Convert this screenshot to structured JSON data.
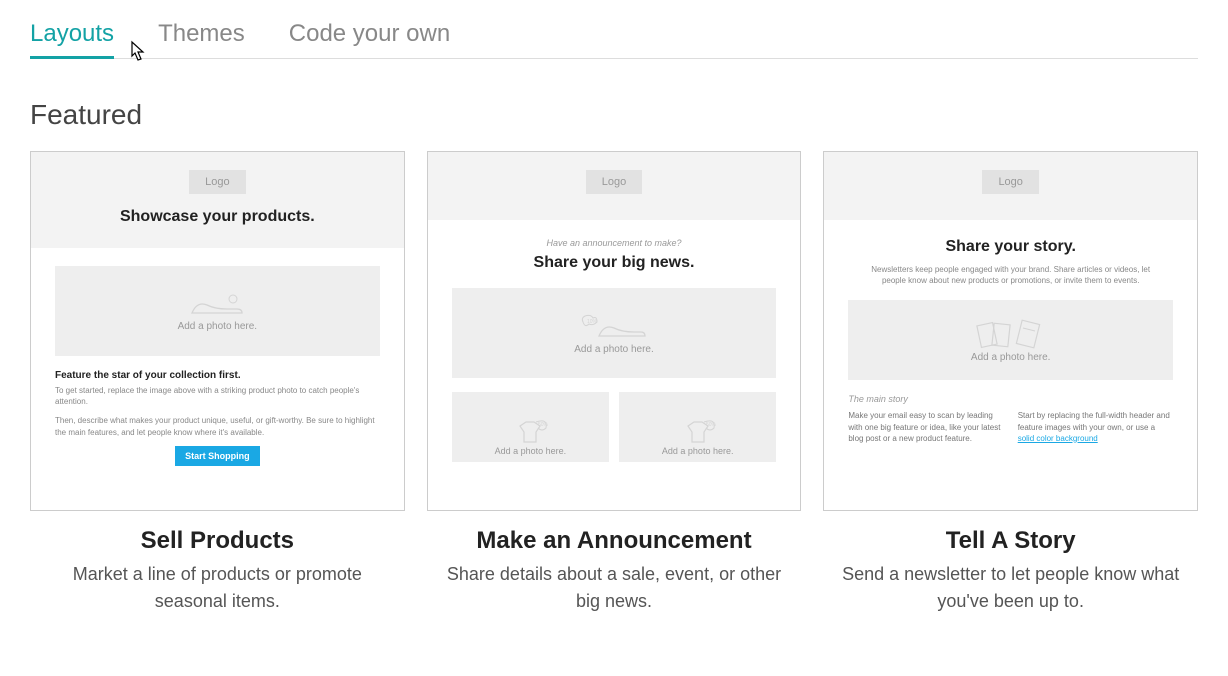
{
  "tabs": [
    {
      "label": "Layouts",
      "active": true
    },
    {
      "label": "Themes",
      "active": false
    },
    {
      "label": "Code your own",
      "active": false
    }
  ],
  "section_title": "Featured",
  "cards": [
    {
      "title": "Sell Products",
      "desc": "Market a line of products or promote seasonal items.",
      "preview": {
        "logo": "Logo",
        "headline": "Showcase your products.",
        "placeholder_text": "Add a photo here.",
        "subhead": "Feature the star of your collection first.",
        "body1": "To get started, replace the image above with a striking product photo to catch people's attention.",
        "body2": "Then, describe what makes your product unique, useful, or gift-worthy. Be sure to highlight the main features, and let people know where it's available.",
        "button": "Start Shopping"
      }
    },
    {
      "title": "Make an Announcement",
      "desc": "Share details about a sale, event, or other big news.",
      "preview": {
        "logo": "Logo",
        "pretitle": "Have an announcement to make?",
        "headline": "Share your big news.",
        "placeholder_text": "Add a photo here.",
        "half_text": "Add a photo here."
      }
    },
    {
      "title": "Tell A Story",
      "desc": "Send a newsletter to let people know what you've been up to.",
      "preview": {
        "logo": "Logo",
        "headline": "Share your story.",
        "intro": "Newsletters keep people engaged with your brand. Share articles or videos, let people know about new products or promotions, or invite them to events.",
        "placeholder_text": "Add a photo here.",
        "story_label": "The main story",
        "col1": "Make your email easy to scan by leading with one big feature or idea, like your latest blog post or a new product feature.",
        "col2_a": "Start by replacing the full-width header and feature images with your own, or use a ",
        "col2_link": "solid color background"
      }
    }
  ]
}
